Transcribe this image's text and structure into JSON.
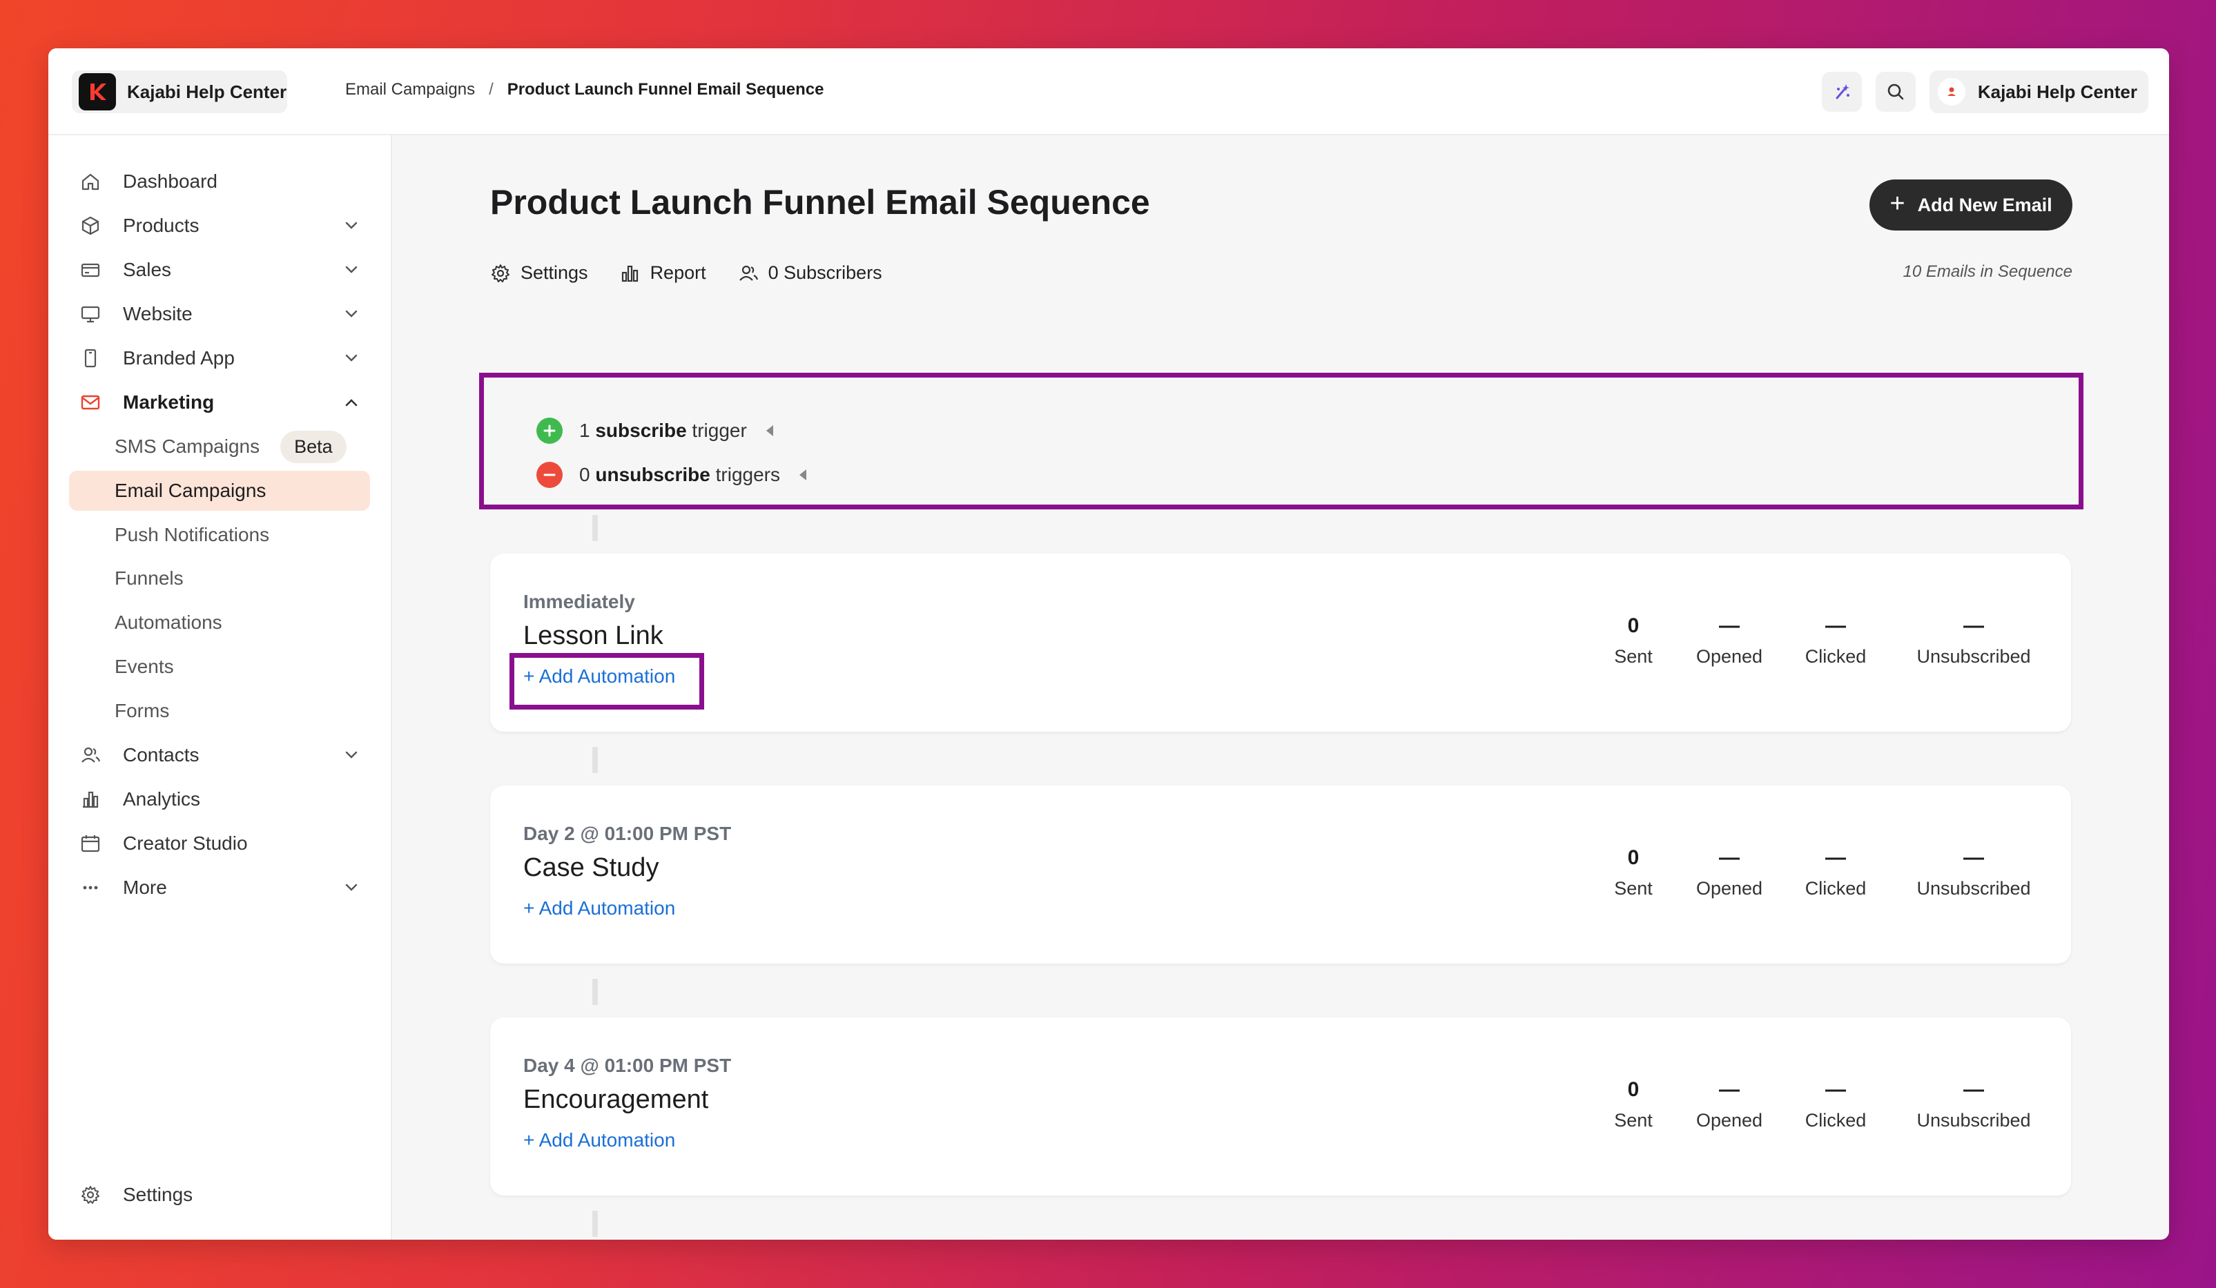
{
  "brand": {
    "name": "Kajabi Help Center"
  },
  "breadcrumb": {
    "parent": "Email Campaigns",
    "separator": "/",
    "current": "Product Launch Funnel Email Sequence"
  },
  "account": {
    "name": "Kajabi Help Center"
  },
  "sidebar": {
    "items": [
      {
        "label": "Dashboard",
        "icon": "home-icon"
      },
      {
        "label": "Products",
        "icon": "box-icon"
      },
      {
        "label": "Sales",
        "icon": "credit-card-icon"
      },
      {
        "label": "Website",
        "icon": "monitor-icon"
      },
      {
        "label": "Branded App",
        "icon": "phone-icon"
      },
      {
        "label": "Marketing",
        "icon": "mail-icon"
      },
      {
        "label": "Contacts",
        "icon": "users-icon"
      },
      {
        "label": "Analytics",
        "icon": "bar-chart-icon"
      },
      {
        "label": "Creator Studio",
        "icon": "calendar-icon"
      },
      {
        "label": "More",
        "icon": "ellipsis-icon"
      }
    ],
    "marketing_sub": [
      {
        "label": "SMS Campaigns",
        "badge": "Beta"
      },
      {
        "label": "Email Campaigns"
      },
      {
        "label": "Push Notifications"
      },
      {
        "label": "Funnels"
      },
      {
        "label": "Automations"
      },
      {
        "label": "Events"
      },
      {
        "label": "Forms"
      }
    ],
    "settings_label": "Settings"
  },
  "page": {
    "title": "Product Launch Funnel Email Sequence",
    "add_button": "Add New Email",
    "tabs": {
      "settings": "Settings",
      "report": "Report",
      "subscribers": "0 Subscribers"
    },
    "sequence_count": "10 Emails in Sequence"
  },
  "triggers": {
    "subscribe": {
      "count": "1",
      "bold": "subscribe",
      "rest": "trigger"
    },
    "unsubscribe": {
      "count": "0",
      "bold": "unsubscribe",
      "rest": "triggers"
    }
  },
  "stat_labels": {
    "sent": "Sent",
    "opened": "Opened",
    "clicked": "Clicked",
    "unsubscribed": "Unsubscribed"
  },
  "emails": [
    {
      "when": "Immediately",
      "name": "Lesson Link",
      "add_automation": "+ Add Automation",
      "sent": "0",
      "opened": "—",
      "clicked": "—",
      "unsubscribed": "—"
    },
    {
      "when": "Day 2 @ 01:00 PM PST",
      "name": "Case Study",
      "add_automation": "+ Add Automation",
      "sent": "0",
      "opened": "—",
      "clicked": "—",
      "unsubscribed": "—"
    },
    {
      "when": "Day 4 @ 01:00 PM PST",
      "name": "Encouragement",
      "add_automation": "+ Add Automation",
      "sent": "0",
      "opened": "—",
      "clicked": "—",
      "unsubscribed": "—"
    }
  ],
  "colors": {
    "accent_highlight": "#8a0f8e",
    "link": "#1a6fd6",
    "active_nav_bg": "#fde4d8",
    "marketing_icon": "#e8432e"
  }
}
